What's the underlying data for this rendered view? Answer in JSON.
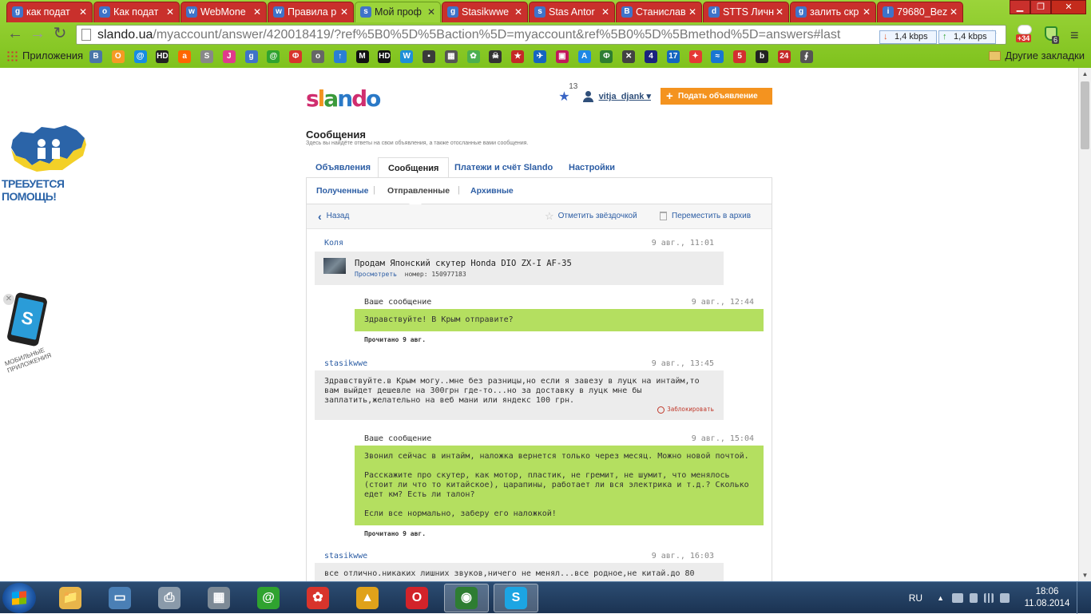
{
  "browser": {
    "tabs": [
      {
        "title": "как подат",
        "icon": "g"
      },
      {
        "title": "Как подат",
        "icon": "o"
      },
      {
        "title": "WebMone",
        "icon": "w"
      },
      {
        "title": "Правила р",
        "icon": "w"
      },
      {
        "title": "Мой проф",
        "icon": "s",
        "active": true
      },
      {
        "title": "Stasikwwe",
        "icon": "g"
      },
      {
        "title": "Stas Antor",
        "icon": "s"
      },
      {
        "title": "Станислав",
        "icon": "В"
      },
      {
        "title": "STTS Личн",
        "icon": "d"
      },
      {
        "title": "залить скр",
        "icon": "g"
      },
      {
        "title": "79680_Bez",
        "icon": "i"
      }
    ],
    "url_domain": "slando.ua",
    "url_path": "/myaccount/answer/420018419/?ref%5B0%5D%5Baction%5D=myaccount&ref%5B0%5D%5Bmethod%5D=answers#last",
    "speed_down": "1,4 kbps",
    "speed_up": "1,4 kbps",
    "ext_badge_1": "+34",
    "ext_badge_2": "6",
    "bookmarks_apps_label": "Приложения",
    "bookmarks_other_label": "Другие закладки",
    "bookmark_icons": [
      {
        "label": "В",
        "color": "#4a76a8"
      },
      {
        "label": "О",
        "color": "#f59a23"
      },
      {
        "label": "@",
        "color": "#168de2"
      },
      {
        "label": "HD",
        "color": "#222222"
      },
      {
        "label": "a",
        "color": "#ff6600"
      },
      {
        "label": "S",
        "color": "#888888"
      },
      {
        "label": "J",
        "color": "#e03a8c"
      },
      {
        "label": "g",
        "color": "#3f73c9"
      },
      {
        "label": "@",
        "color": "#2fa32f"
      },
      {
        "label": "Ф",
        "color": "#d8342c"
      },
      {
        "label": "o",
        "color": "#666666"
      },
      {
        "label": "↑",
        "color": "#2a7fd4"
      },
      {
        "label": "M",
        "color": "#111111"
      },
      {
        "label": "HD",
        "color": "#111111"
      },
      {
        "label": "W",
        "color": "#1e90d8"
      },
      {
        "label": "▪",
        "color": "#3a3a3a"
      },
      {
        "label": "▦",
        "color": "#555555"
      },
      {
        "label": "✿",
        "color": "#4caf50"
      },
      {
        "label": "☠",
        "color": "#333333"
      },
      {
        "label": "★",
        "color": "#c62828"
      },
      {
        "label": "✈",
        "color": "#1565c0"
      },
      {
        "label": "▣",
        "color": "#c2185b"
      },
      {
        "label": "A",
        "color": "#1e88e5"
      },
      {
        "label": "Ф",
        "color": "#2e7d32"
      },
      {
        "label": "✕",
        "color": "#424242"
      },
      {
        "label": "4",
        "color": "#1a237e"
      },
      {
        "label": "17",
        "color": "#1565c0"
      },
      {
        "label": "✦",
        "color": "#e53935"
      },
      {
        "label": "≈",
        "color": "#1976d2"
      },
      {
        "label": "5",
        "color": "#d32f2f"
      },
      {
        "label": "b",
        "color": "#222222"
      },
      {
        "label": "24",
        "color": "#c62828"
      },
      {
        "label": "∮",
        "color": "#555555"
      }
    ]
  },
  "side": {
    "help_text": "ТРЕБУЕТСЯ ПОМОЩЬ!",
    "mobile_text": "МОБИЛЬНЫЕ ПРИЛОЖЕНИЯ"
  },
  "header": {
    "logo": "slando",
    "stars_count": "13",
    "username": "vitja_djank ▾",
    "post_button": "Подать объявление"
  },
  "page": {
    "title": "Сообщения",
    "subtitle": "Здесь вы найдёте ответы на свои объявления, а также отосланные вами сообщения.",
    "tabs": [
      "Объявления",
      "Сообщения",
      "Платежи и счёт Slando",
      "Настройки"
    ],
    "subtabs": [
      "Полученные",
      "Отправленные",
      "Архивные"
    ],
    "back": "Назад",
    "star_action": "Отметить звёздочкой",
    "archive_action": "Переместить в архив"
  },
  "messages": [
    {
      "author": "Коля",
      "time": "9 авг., 11:01",
      "product_title": "Продам Японский скутер Honda DIO ZX-I AF-35",
      "product_view": "Просмотреть",
      "product_number": "номер: 150977183"
    },
    {
      "author": "Ваше сообщение",
      "time": "9 авг., 12:44",
      "text": "Здравствуйте! В Крым отправите?",
      "read": "Прочитано 9 авг."
    },
    {
      "author": "stasikwwe",
      "time": "9 авг., 13:45",
      "text": "Здравствуйте.в Крым могу..мне без разницы,но если я завезу в луцк на интайм,то вам выйдет дешевле на 300грн где-то...но за доставку в луцк мне бы заплатить,желательно на веб мани или яндекс 100 грн.",
      "block": "Заблокировать"
    },
    {
      "author": "Ваше сообщение",
      "time": "9 авг., 15:04",
      "text_1": "Звонил сейчас в интайм, наложка вернется только через месяц. Можно новой почтой.",
      "text_2": "Расскажите про скутер, как мотор, пластик, не гремит, не шумит, что менялось (стоит ли что то китайское), царапины, работает ли вся электрика и т.д.? Сколько едет км? Есть ли талон?",
      "text_3": "Если все нормально, заберу его наложкой!",
      "read": "Прочитано 9 авг."
    },
    {
      "author": "stasikwwe",
      "time": "9 авг., 16:03",
      "text": "все отлично.никаких лишних звуков,ничего не менял...все родное,не китай.до 80"
    }
  ],
  "taskbar": {
    "apps": [
      {
        "name": "explorer",
        "label": "📁",
        "color": "#e8b54a"
      },
      {
        "name": "computer",
        "label": "▭",
        "color": "#4a7fb5"
      },
      {
        "name": "printer",
        "label": "⎙",
        "color": "#8a9aaa"
      },
      {
        "name": "calculator",
        "label": "▦",
        "color": "#7d8a96"
      },
      {
        "name": "mail-agent",
        "label": "@",
        "color": "#2fa32f"
      },
      {
        "name": "huawei",
        "label": "✿",
        "color": "#d8342c"
      },
      {
        "name": "avast",
        "label": "▲",
        "color": "#e0a21a"
      },
      {
        "name": "opera",
        "label": "O",
        "color": "#d2232a"
      },
      {
        "name": "chrome",
        "label": "◉",
        "color": "#2e7d32",
        "active": true
      },
      {
        "name": "skype",
        "label": "S",
        "color": "#1ca5e3",
        "active": true
      }
    ],
    "lang": "RU",
    "time": "18:06",
    "date": "11.08.2014"
  }
}
